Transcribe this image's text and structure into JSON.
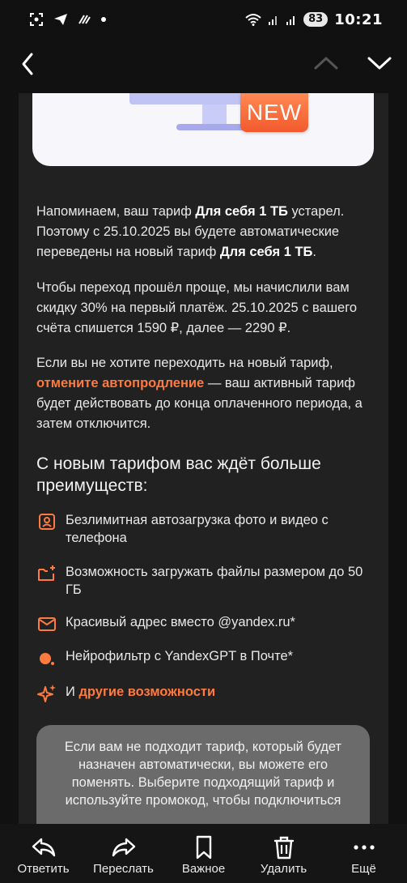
{
  "status_bar": {
    "time": "10:21",
    "battery": "83"
  },
  "banner": {
    "badge": "NEW"
  },
  "message": {
    "p1_a": "Напоминаем, ваш тариф ",
    "p1_b": "Для себя 1 ТБ",
    "p1_c": " устарел. Поэтому с 25.10.2025 вы будете автоматические переведены на новый тариф ",
    "p1_d": "Для себя 1 ТБ",
    "p1_e": ".",
    "p2": "Чтобы переход прошёл проще, мы начислили вам скидку 30% на первый платёж. 25.10.2025 с вашего счёта спишется 1590 ₽, далее — 2290 ₽.",
    "p3_a": "Если вы не хотите переходить на новый тариф, ",
    "p3_link": "отмените автопродление",
    "p3_b": " — ваш активный тариф будет действовать до конца оплаченного периода, а затем отключится.",
    "heading": "С новым тарифом вас ждёт больше преимуществ:",
    "features": [
      {
        "icon": "photo-icon",
        "text": "Безлимитная автозагрузка фото и видео с телефона"
      },
      {
        "icon": "folder-plus-icon",
        "text": "Возможность загружать файлы размером до 50 ГБ"
      },
      {
        "icon": "mail-icon",
        "text": "Красивый адрес вместо @yandex.ru*"
      },
      {
        "icon": "dot-icon",
        "text": "Нейрофильтр с YandexGPT в Почте*"
      }
    ],
    "more_prefix": "И ",
    "more_link": "другие возможности",
    "note": "Если вам не подходит тариф, который будет назначен автоматически, вы можете его поменять. Выберите подходящий тариф и используйте промокод, чтобы подключиться"
  },
  "toolbar": {
    "reply": "Ответить",
    "forward": "Переслать",
    "important": "Важное",
    "delete": "Удалить",
    "more": "Ещё"
  },
  "colors": {
    "accent": "#ff7a3f",
    "background": "#111111",
    "mail_bg": "#212121"
  }
}
